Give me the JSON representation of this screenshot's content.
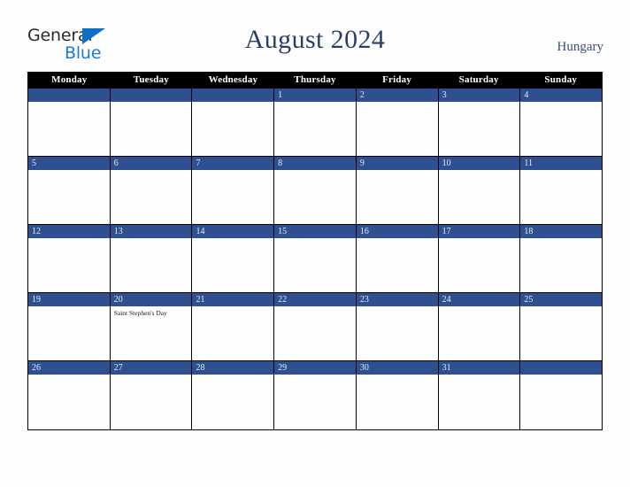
{
  "brand": {
    "name_top": "General",
    "name_bottom": "Blue",
    "triangle_icon": "triangle-icon",
    "color_dark": "#2b2b2b",
    "color_blue": "#1a7ad4"
  },
  "header": {
    "title": "August 2024",
    "country": "Hungary"
  },
  "colors": {
    "accent_blue": "#2e5090",
    "header_black": "#000000",
    "title_navy": "#2b3f66",
    "page_background": "#fdfdfd",
    "cell_background": "#fefefe"
  },
  "calendar": {
    "month": "August",
    "year": "2024",
    "weekday_headers": [
      "Monday",
      "Tuesday",
      "Wednesday",
      "Thursday",
      "Friday",
      "Saturday",
      "Sunday"
    ],
    "weeks": [
      [
        {
          "day": "",
          "events": []
        },
        {
          "day": "",
          "events": []
        },
        {
          "day": "",
          "events": []
        },
        {
          "day": "1",
          "events": []
        },
        {
          "day": "2",
          "events": []
        },
        {
          "day": "3",
          "events": []
        },
        {
          "day": "4",
          "events": []
        }
      ],
      [
        {
          "day": "5",
          "events": []
        },
        {
          "day": "6",
          "events": []
        },
        {
          "day": "7",
          "events": []
        },
        {
          "day": "8",
          "events": []
        },
        {
          "day": "9",
          "events": []
        },
        {
          "day": "10",
          "events": []
        },
        {
          "day": "11",
          "events": []
        }
      ],
      [
        {
          "day": "12",
          "events": []
        },
        {
          "day": "13",
          "events": []
        },
        {
          "day": "14",
          "events": []
        },
        {
          "day": "15",
          "events": []
        },
        {
          "day": "16",
          "events": []
        },
        {
          "day": "17",
          "events": []
        },
        {
          "day": "18",
          "events": []
        }
      ],
      [
        {
          "day": "19",
          "events": []
        },
        {
          "day": "20",
          "events": [
            "Saint Stephen's Day"
          ]
        },
        {
          "day": "21",
          "events": []
        },
        {
          "day": "22",
          "events": []
        },
        {
          "day": "23",
          "events": []
        },
        {
          "day": "24",
          "events": []
        },
        {
          "day": "25",
          "events": []
        }
      ],
      [
        {
          "day": "26",
          "events": []
        },
        {
          "day": "27",
          "events": []
        },
        {
          "day": "28",
          "events": []
        },
        {
          "day": "29",
          "events": []
        },
        {
          "day": "30",
          "events": []
        },
        {
          "day": "31",
          "events": []
        },
        {
          "day": "",
          "events": []
        }
      ]
    ]
  }
}
